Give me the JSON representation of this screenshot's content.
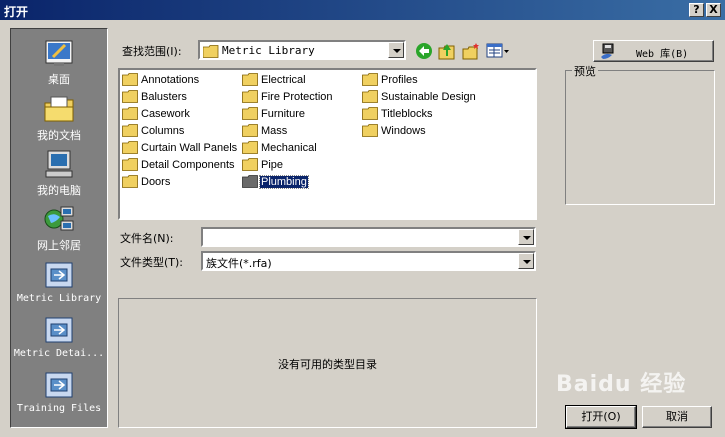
{
  "window": {
    "title": "打开",
    "help_button": "?",
    "close_button": "X"
  },
  "places": [
    {
      "label": "桌面",
      "icon": "desktop-icon"
    },
    {
      "label": "我的文档",
      "icon": "my-documents-icon"
    },
    {
      "label": "我的电脑",
      "icon": "my-computer-icon"
    },
    {
      "label": "网上邻居",
      "icon": "network-icon"
    },
    {
      "label": "Metric Library",
      "icon": "folder-shortcut-icon"
    },
    {
      "label": "Metric Detai...",
      "icon": "folder-shortcut-icon"
    },
    {
      "label": "Training Files",
      "icon": "folder-shortcut-icon"
    }
  ],
  "lookin": {
    "label": "查找范围(I):",
    "value": "Metric Library"
  },
  "files": [
    {
      "name": "Annotations"
    },
    {
      "name": "Balusters"
    },
    {
      "name": "Casework"
    },
    {
      "name": "Columns"
    },
    {
      "name": "Curtain Wall Panels"
    },
    {
      "name": "Detail Components"
    },
    {
      "name": "Doors"
    },
    {
      "name": "Electrical"
    },
    {
      "name": "Fire Protection"
    },
    {
      "name": "Furniture"
    },
    {
      "name": "Mass"
    },
    {
      "name": "Mechanical"
    },
    {
      "name": "Pipe"
    },
    {
      "name": "Plumbing",
      "selected": true
    },
    {
      "name": "Profiles"
    },
    {
      "name": "Sustainable Design"
    },
    {
      "name": "Titleblocks"
    },
    {
      "name": "Windows"
    }
  ],
  "filename": {
    "label": "文件名(N):",
    "value": ""
  },
  "filetype": {
    "label": "文件类型(T):",
    "value": "族文件(*.rfa)"
  },
  "catalog": {
    "message": "没有可用的类型目录"
  },
  "web_button": "Web 库(B)",
  "preview_label": "预览",
  "open_button": "打开(O)",
  "cancel_button": "取消",
  "watermark": "Baidu 经验"
}
